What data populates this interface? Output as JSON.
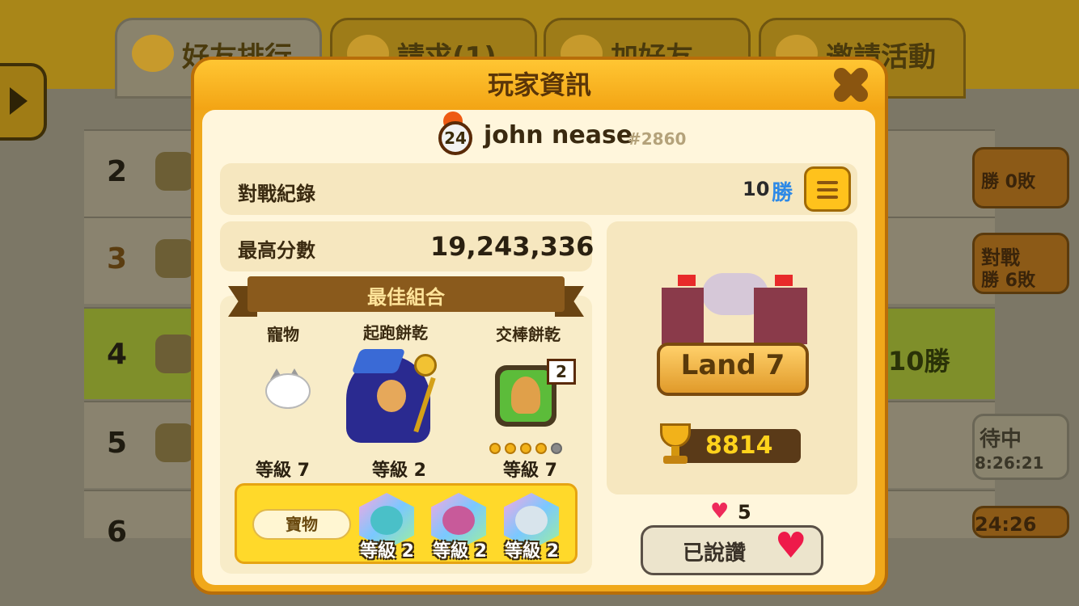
{
  "background": {
    "tabs": [
      {
        "label": "好友排行",
        "active": true
      },
      {
        "label": "請求(1)",
        "active": false
      },
      {
        "label": "加好友",
        "active": false
      },
      {
        "label": "邀請活動",
        "active": false
      }
    ],
    "rows": [
      {
        "rank": "2",
        "right_text": "勝 0敗"
      },
      {
        "rank": "3",
        "right_title": "對戰",
        "right_text": "勝 6敗"
      },
      {
        "rank": "4",
        "right_text": "10勝"
      },
      {
        "rank": "5",
        "right_title": "待中",
        "right_text": "8:26:21"
      },
      {
        "rank": "6",
        "right_text": "24:26"
      }
    ]
  },
  "dialog": {
    "title": "玩家資訊",
    "player": {
      "level": "24",
      "name": "john nease",
      "tag": "#2860"
    },
    "record": {
      "label": "對戰紀錄",
      "wins": "10",
      "wins_unit": "勝"
    },
    "best_score": {
      "label": "最高分數",
      "value": "19,243,336"
    },
    "combo": {
      "title": "最佳組合",
      "pet": {
        "label": "寵物",
        "level": "等級 7"
      },
      "cookie": {
        "label": "起跑餅乾",
        "level": "等級 2"
      },
      "relay": {
        "label": "交棒餅乾",
        "level": "等級 7",
        "badge": "2",
        "stars": 4,
        "max_stars": 5
      }
    },
    "treasures": {
      "label": "寶物",
      "items": [
        {
          "icon": "blaster-treasure-icon",
          "level": "等級 2"
        },
        {
          "icon": "cake-treasure-icon",
          "level": "等級 2"
        },
        {
          "icon": "crown-treasure-icon",
          "level": "等級 2"
        }
      ]
    },
    "land": {
      "label": "Land 7",
      "trophies": "8814"
    },
    "likes": {
      "count": "5",
      "button_label": "已說讚"
    }
  },
  "colors": {
    "accent": "#f0a81a",
    "panel": "#fff6dc",
    "heart": "#ee1a4a",
    "win_blue": "#2f8ae6"
  }
}
